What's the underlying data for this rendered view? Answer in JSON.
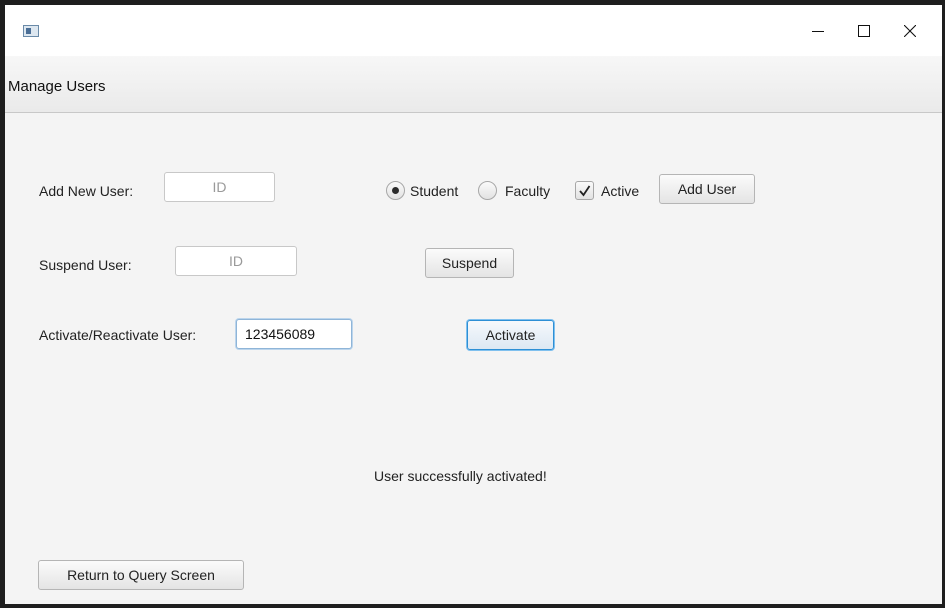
{
  "menu": {
    "title": "Manage Users"
  },
  "add_user": {
    "label": "Add New User:",
    "id_placeholder": "ID",
    "roles": [
      "Student",
      "Faculty"
    ],
    "selected_role": "Student",
    "active_label": "Active",
    "active_checked": true,
    "button_label": "Add User"
  },
  "suspend_user": {
    "label": "Suspend User:",
    "id_placeholder": "ID",
    "button_label": "Suspend"
  },
  "activate_user": {
    "label": "Activate/Reactivate User:",
    "id_value": "123456089",
    "button_label": "Activate"
  },
  "status_message": "User successfully activated!",
  "footer": {
    "return_label": "Return to Query Screen"
  }
}
